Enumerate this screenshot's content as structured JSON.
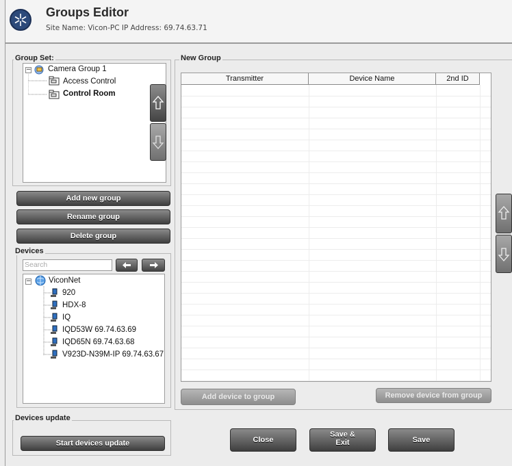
{
  "header": {
    "title": "Groups Editor",
    "site_line": "Site Name: Vicon-PC   IP Address: 69.74.63.71"
  },
  "group_set": {
    "legend": "Group Set:",
    "items": [
      {
        "label": "Camera Group 1",
        "level": 0,
        "icon": "camera-group-icon",
        "bold": false
      },
      {
        "label": "Access Control",
        "level": 1,
        "icon": "folder-camera-icon",
        "bold": false
      },
      {
        "label": "Control Room",
        "level": 1,
        "icon": "folder-camera-icon",
        "bold": true
      }
    ]
  },
  "group_buttons": {
    "add": "Add new group",
    "rename": "Rename group",
    "delete": "Delete group"
  },
  "devices": {
    "legend": "Devices",
    "search_placeholder": "Search",
    "root": "ViconNet",
    "items": [
      "920",
      "HDX-8",
      "IQ",
      "IQD53W 69.74.63.69",
      "IQD65N 69.74.63.68",
      "V923D-N39M-IP 69.74.63.67"
    ]
  },
  "new_group": {
    "legend": "New Group",
    "columns": [
      "Transmitter",
      "Device Name",
      "2nd ID"
    ],
    "add_device": "Add device to group",
    "remove_device": "Remove device from group"
  },
  "devices_update": {
    "legend": "Devices update",
    "start": "Start devices update"
  },
  "footer": {
    "close": "Close",
    "save_exit_1": "Save &",
    "save_exit_2": "Exit",
    "save": "Save"
  }
}
